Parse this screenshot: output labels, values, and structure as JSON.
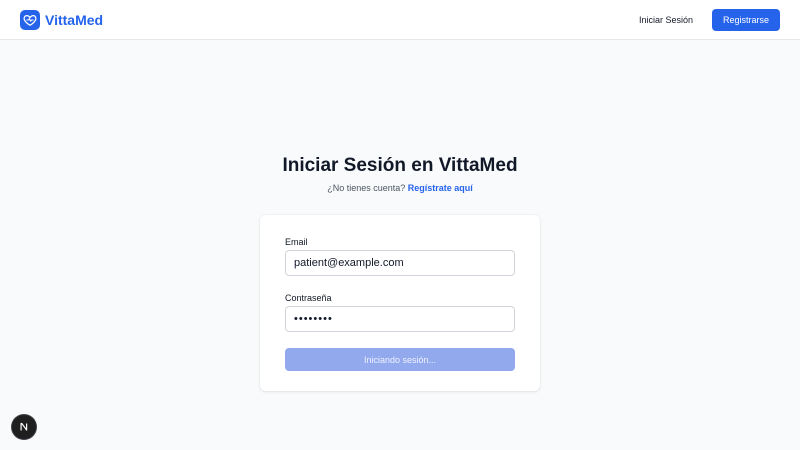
{
  "app": {
    "name": "VittaMed",
    "brand_color": "#2563eb",
    "logo_icon": "heart-pulse-icon"
  },
  "nav": {
    "login_label": "Iniciar Sesión",
    "register_label": "Registrarse"
  },
  "login": {
    "title": "Iniciar Sesión en VittaMed",
    "subtitle_prefix": "¿No tienes cuenta?",
    "register_link": "Regístrate aquí",
    "email": {
      "label": "Email",
      "value": "patient@example.com"
    },
    "password": {
      "label": "Contraseña",
      "value": "password"
    },
    "submit_label": "Iniciando sesión...",
    "submit_state": "loading"
  },
  "dev_indicator": {
    "letter": "N",
    "icon": "nextjs-icon"
  }
}
